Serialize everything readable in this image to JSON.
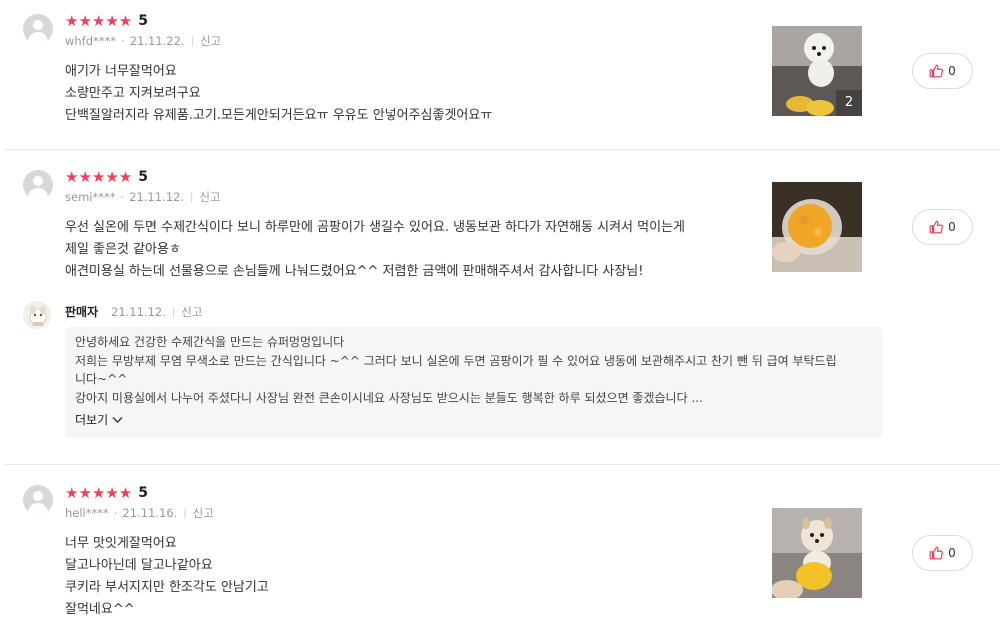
{
  "reviews": [
    {
      "rating": "★★★★★",
      "score": "5",
      "user": "whfd****",
      "date": "21.11.22.",
      "report": "신고",
      "lines": [
        "애기가 너무잘먹어요",
        "소량만주고 지켜보려구요",
        "단백질알러지라 유제품.고기.모든게안되거든요ㅠ 우유도 안넣어주심좋겟어요ㅠ"
      ],
      "photo_count": "2",
      "likes": "0"
    },
    {
      "rating": "★★★★★",
      "score": "5",
      "user": "semi****",
      "date": "21.11.12.",
      "report": "신고",
      "lines": [
        "우선 실온에 두면 수제간식이다 보니 하루만에 곰팡이가 생길수 있어요. 냉동보관 하다가 자연해동 시켜서 먹이는게",
        "제일 좋은것 같아용ㅎ",
        "애견미용실 하는데 선물용으로 손님들께 나눠드렸어요^^ 저렴한 금액에 판매해주셔서 감사합니다 사장님!"
      ],
      "likes": "0",
      "seller_reply": {
        "name": "판매자",
        "date": "21.11.12.",
        "report": "신고",
        "lines": [
          "안녕하세요  건강한 수제간식을 만드는 슈퍼멍멍입니다",
          "저희는 무방부제 무염 무색소로 만드는 간식입니다 ~^^ 그러다 보니 실온에 두면 곰팡이가 필 수 있어요 냉동에 보관해주시고 찬기 뺀 뒤 급여 부탁드립",
          "니다~^^",
          "강아지 미용실에서 나누어 주셨다니 사장님 완전 큰손이시네요 사장님도 받으시는 분들도 행복한 하루 되셨으면 좋겠습니다 ..."
        ],
        "more_label": "더보기"
      }
    },
    {
      "rating": "★★★★★",
      "score": "5",
      "user": "hell****",
      "date": "21.11.16.",
      "report": "신고",
      "lines": [
        "너무 맛잇게잘먹어요",
        "달고나아닌데 달고나같아요",
        "쿠키라 부서지지만 한조각도 안남기고",
        "잘먹네요^^"
      ],
      "likes": "0"
    }
  ],
  "colors": {
    "star": "#f0405a",
    "divider": "#e8e8e8",
    "reply_bg": "#f5f6f8"
  },
  "icons": {
    "like": "thumbs-up-icon",
    "more": "chevron-down-icon",
    "avatar": "user-avatar-icon"
  }
}
